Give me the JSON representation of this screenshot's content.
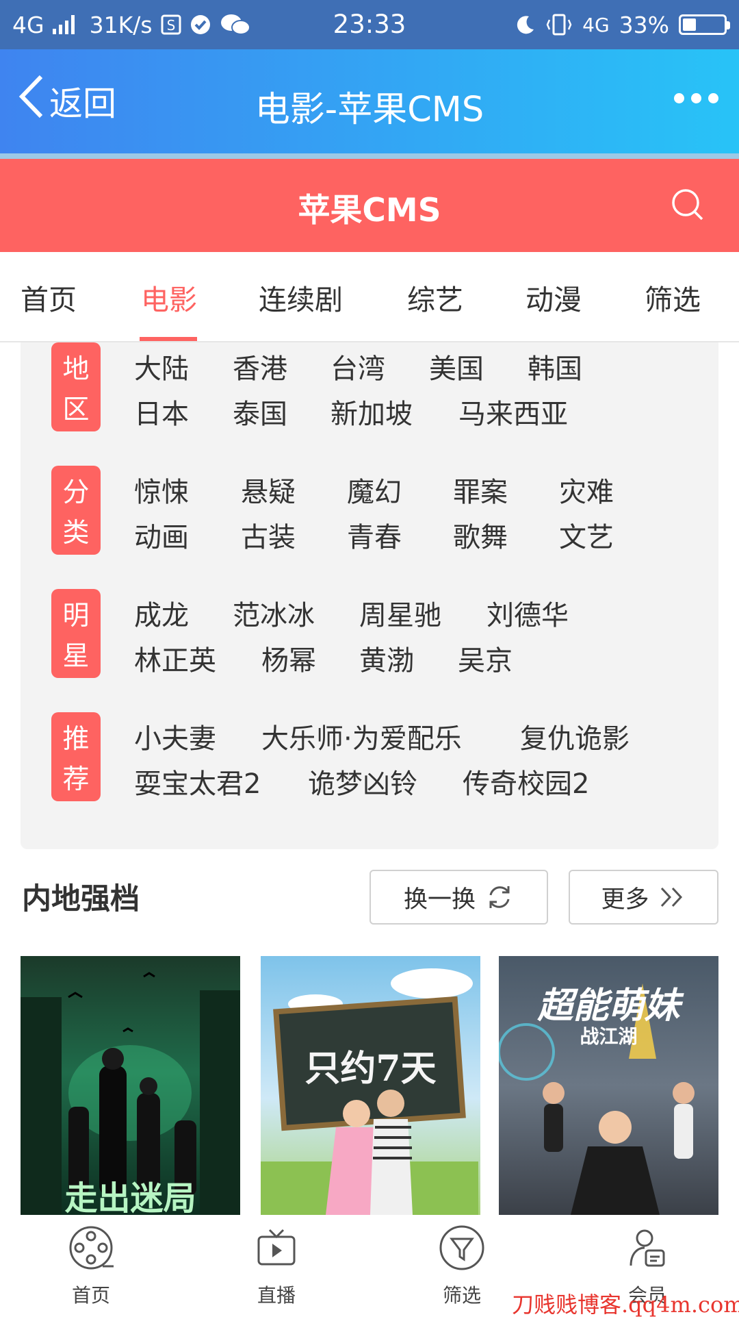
{
  "status_bar": {
    "network": "4G",
    "speed": "31K/s",
    "time": "23:33",
    "network_right": "4G",
    "battery": "33%",
    "battery_level": 0.33
  },
  "title_bar": {
    "back_label": "返回",
    "title": "电影-苹果CMS"
  },
  "site_header": {
    "name": "苹果CMS"
  },
  "nav": {
    "tabs": [
      "首页",
      "电影",
      "连续剧",
      "综艺",
      "动漫",
      "筛选"
    ],
    "active_index": 1
  },
  "filters": [
    {
      "label": [
        "地",
        "区"
      ],
      "rows": [
        [
          "大陆",
          "香港",
          "台湾",
          "美国",
          "韩国"
        ],
        [
          "日本",
          "泰国",
          "新加坡",
          "马来西亚"
        ]
      ]
    },
    {
      "label": [
        "分",
        "类"
      ],
      "rows": [
        [
          "惊悚",
          "悬疑",
          "魔幻",
          "罪案",
          "灾难"
        ],
        [
          "动画",
          "古装",
          "青春",
          "歌舞",
          "文艺"
        ]
      ]
    },
    {
      "label": [
        "明",
        "星"
      ],
      "rows": [
        [
          "成龙",
          "范冰冰",
          "周星驰",
          "刘德华"
        ],
        [
          "林正英",
          "杨幂",
          "黄渤",
          "吴京"
        ]
      ]
    },
    {
      "label": [
        "推",
        "荐"
      ],
      "rows": [
        [
          "小夫妻",
          "大乐师·为爱配乐",
          "复仇诡影"
        ],
        [
          "耍宝太君2",
          "诡梦凶铃",
          "传奇校园2"
        ]
      ]
    }
  ],
  "section": {
    "title": "内地强档",
    "refresh_label": "换一换",
    "more_label": "更多"
  },
  "posters": [
    {
      "title": "走出迷局"
    },
    {
      "title": "只约7天"
    },
    {
      "title": "超能萌妹",
      "subtitle": "战江湖"
    }
  ],
  "bottom_nav": [
    "首页",
    "直播",
    "筛选",
    "会员"
  ],
  "watermark": "刀贱贱博客.qq4m.com",
  "colors": {
    "accent": "#fe6361",
    "titlebar_start": "#3f84f0",
    "titlebar_end": "#28c3f7"
  }
}
